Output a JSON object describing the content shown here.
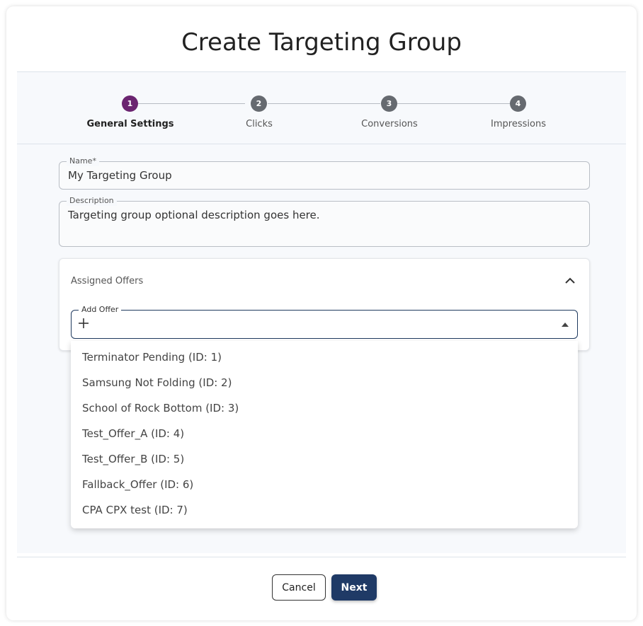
{
  "title": "Create Targeting Group",
  "stepper": {
    "steps": [
      {
        "number": "1",
        "label": "General Settings",
        "active": true
      },
      {
        "number": "2",
        "label": "Clicks",
        "active": false
      },
      {
        "number": "3",
        "label": "Conversions",
        "active": false
      },
      {
        "number": "4",
        "label": "Impressions",
        "active": false
      }
    ]
  },
  "form": {
    "name": {
      "label": "Name",
      "required_mark": "*",
      "value": "My Targeting Group"
    },
    "description": {
      "label": "Description",
      "value": "Targeting group optional description goes here."
    }
  },
  "offers": {
    "section_label": "Assigned Offers",
    "add_offer_label": "Add Offer",
    "options": [
      "Terminator Pending (ID: 1)",
      "Samsung Not Folding (ID: 2)",
      "School of Rock Bottom (ID: 3)",
      "Test_Offer_A (ID: 4)",
      "Test_Offer_B (ID: 5)",
      "Fallback_Offer (ID: 6)",
      "CPA CPX test (ID: 7)"
    ]
  },
  "footer": {
    "cancel_label": "Cancel",
    "next_label": "Next"
  },
  "colors": {
    "active_step": "#6b2470",
    "inactive_step": "#666a70",
    "primary_button": "#1f3a66"
  }
}
